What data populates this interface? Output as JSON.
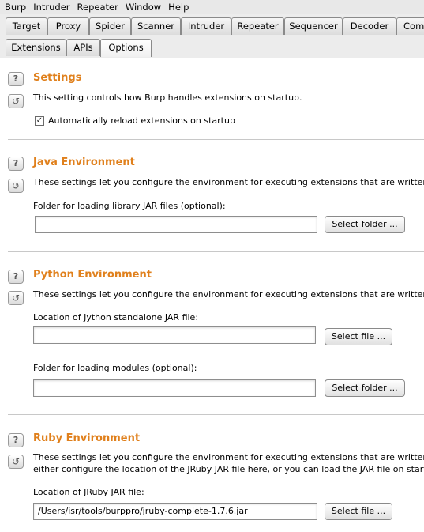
{
  "menu": [
    "Burp",
    "Intruder",
    "Repeater",
    "Window",
    "Help"
  ],
  "main_tabs": [
    "Target",
    "Proxy",
    "Spider",
    "Scanner",
    "Intruder",
    "Repeater",
    "Sequencer",
    "Decoder",
    "Com"
  ],
  "sub_tabs": [
    "Extensions",
    "APIs",
    "Options"
  ],
  "selected_sub_tab": "Options",
  "settings": {
    "title": "Settings",
    "desc": "This setting controls how Burp handles extensions on startup.",
    "checkbox_label": "Automatically reload extensions on startup",
    "checked": true
  },
  "java": {
    "title": "Java Environment",
    "desc": "These settings let you configure the environment for executing extensions that are written in",
    "folder_label": "Folder for loading library JAR files (optional):",
    "folder_value": "",
    "folder_button": "Select folder ..."
  },
  "python": {
    "title": "Python Environment",
    "desc": "These settings let you configure the environment for executing extensions that are written in",
    "jar_label": "Location of Jython standalone JAR file:",
    "jar_value": "",
    "jar_button": "Select file ...",
    "modules_label": "Folder for loading modules (optional):",
    "modules_value": "",
    "modules_button": "Select folder ..."
  },
  "ruby": {
    "title": "Ruby Environment",
    "desc1": "These settings let you configure the environment for executing extensions that are written in",
    "desc2": "either configure the location of the JRuby JAR file here, or you can load the JAR file on startup",
    "jar_label": "Location of JRuby JAR file:",
    "jar_value": "/Users/isr/tools/burppro/jruby-complete-1.7.6.jar",
    "jar_button": "Select file ..."
  },
  "icons": {
    "help": "question-mark-icon",
    "reset": "refresh-icon"
  }
}
